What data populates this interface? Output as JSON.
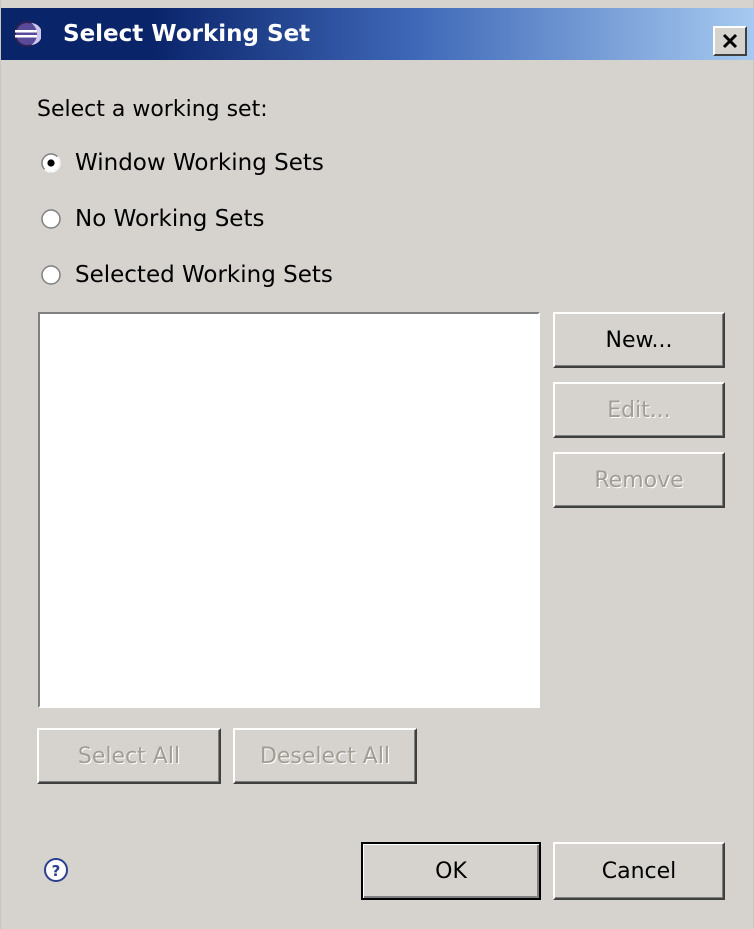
{
  "window": {
    "title": "Select Working Set",
    "close_label": "×"
  },
  "prompt": "Select a working set:",
  "radios": [
    {
      "label": "Window Working Sets",
      "checked": true
    },
    {
      "label": "No Working Sets",
      "checked": false
    },
    {
      "label": "Selected Working Sets",
      "checked": false
    }
  ],
  "working_sets": [],
  "side_buttons": {
    "new_label": "New...",
    "edit_label": "Edit...",
    "remove_label": "Remove"
  },
  "list_buttons": {
    "select_all_label": "Select All",
    "deselect_all_label": "Deselect All"
  },
  "footer": {
    "ok_label": "OK",
    "cancel_label": "Cancel",
    "help_icon": "question-mark-icon"
  },
  "colors": {
    "dialog_bg": "#d6d3ce",
    "title_start": "#0a246a",
    "title_end": "#a6caf0",
    "disabled_text": "#a19d95"
  }
}
